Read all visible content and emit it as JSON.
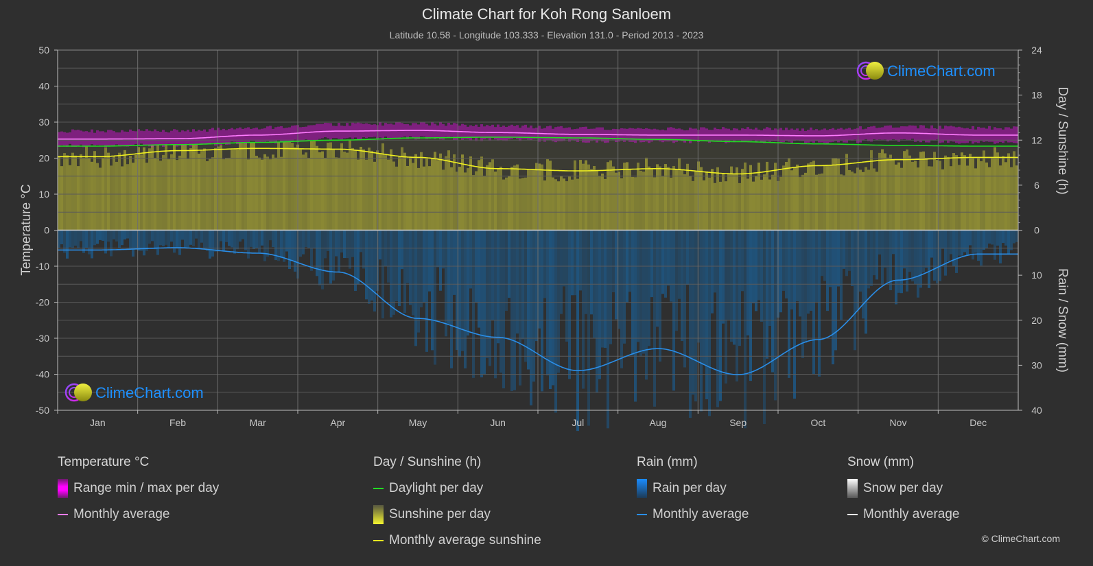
{
  "header": {
    "title": "Climate Chart for Koh Rong Sanloem",
    "subtitle": "Latitude 10.58 - Longitude 103.333 - Elevation 131.0 - Period 2013 - 2023"
  },
  "logo_text": "ClimeChart.com",
  "copyright": "© ClimeChart.com",
  "colors": {
    "background": "#2f2f2f",
    "temperature_range": "#e010e0",
    "temperature_avg": "#ff7cff",
    "daylight": "#22dd22",
    "sunshine_fill": "#8c8a35",
    "sunshine_avg": "#f0f020",
    "rain_fill": "#1d5a8a",
    "rain_avg": "#2a8ee8",
    "snow_avg": "#ffffff",
    "logo_blue": "#1e90ff"
  },
  "legend": {
    "temperature": {
      "heading": "Temperature °C",
      "items": [
        "Range min / max per day",
        "Monthly average"
      ]
    },
    "sunshine": {
      "heading": "Day / Sunshine (h)",
      "items": [
        "Daylight per day",
        "Sunshine per day",
        "Monthly average sunshine"
      ]
    },
    "rain": {
      "heading": "Rain (mm)",
      "items": [
        "Rain per day",
        "Monthly average"
      ]
    },
    "snow": {
      "heading": "Snow (mm)",
      "items": [
        "Snow per day",
        "Monthly average"
      ]
    }
  },
  "chart_data": {
    "type": "line",
    "title": "Climate Chart for Koh Rong Sanloem",
    "categories": [
      "Jan",
      "Feb",
      "Mar",
      "Apr",
      "May",
      "Jun",
      "Jul",
      "Aug",
      "Sep",
      "Oct",
      "Nov",
      "Dec"
    ],
    "axes": {
      "left": {
        "label": "Temperature °C",
        "range": [
          -50,
          50
        ],
        "ticks": [
          50,
          40,
          30,
          20,
          10,
          0,
          -10,
          -20,
          -30,
          -40,
          -50
        ]
      },
      "right_top": {
        "label": "Day / Sunshine (h)",
        "range": [
          0,
          24
        ],
        "ticks": [
          24,
          18,
          12,
          6,
          0
        ]
      },
      "right_bottom": {
        "label": "Rain / Snow (mm)",
        "range": [
          0,
          40
        ],
        "ticks": [
          10,
          20,
          30,
          40
        ]
      }
    },
    "grid": true,
    "series": [
      {
        "name": "Temperature monthly average (°C)",
        "axis": "left",
        "values": [
          25.3,
          25.4,
          26.4,
          27.5,
          27.7,
          27.1,
          26.6,
          26.4,
          26.4,
          26.2,
          27.0,
          26.4
        ]
      },
      {
        "name": "Temperature daily range min (°C)",
        "axis": "left",
        "values": [
          23.5,
          23.6,
          24.4,
          25.4,
          25.6,
          25.2,
          24.8,
          24.6,
          24.6,
          24.4,
          25.0,
          24.4
        ]
      },
      {
        "name": "Temperature daily range max (°C)",
        "axis": "left",
        "values": [
          27.5,
          27.6,
          28.4,
          29.4,
          29.6,
          29.0,
          28.4,
          28.2,
          28.2,
          28.0,
          28.8,
          28.4
        ]
      },
      {
        "name": "Daylight per day (h)",
        "axis": "right_top",
        "values": [
          11.2,
          11.4,
          11.7,
          12.0,
          12.3,
          12.4,
          12.3,
          12.1,
          11.8,
          11.5,
          11.3,
          11.2
        ]
      },
      {
        "name": "Monthly average sunshine (h)",
        "axis": "right_top",
        "values": [
          9.8,
          10.6,
          10.9,
          10.8,
          9.7,
          8.2,
          7.9,
          8.2,
          7.5,
          8.6,
          9.4,
          9.7
        ]
      },
      {
        "name": "Rain monthly average (mm)",
        "axis": "right_bottom",
        "values": [
          4.4,
          3.9,
          5.1,
          9.3,
          19.6,
          23.8,
          31.2,
          26.3,
          32.1,
          24.3,
          11.1,
          5.3
        ]
      },
      {
        "name": "Snow monthly average (mm)",
        "axis": "right_bottom",
        "values": [
          0,
          0,
          0,
          0,
          0,
          0,
          0,
          0,
          0,
          0,
          0,
          0
        ]
      }
    ]
  }
}
